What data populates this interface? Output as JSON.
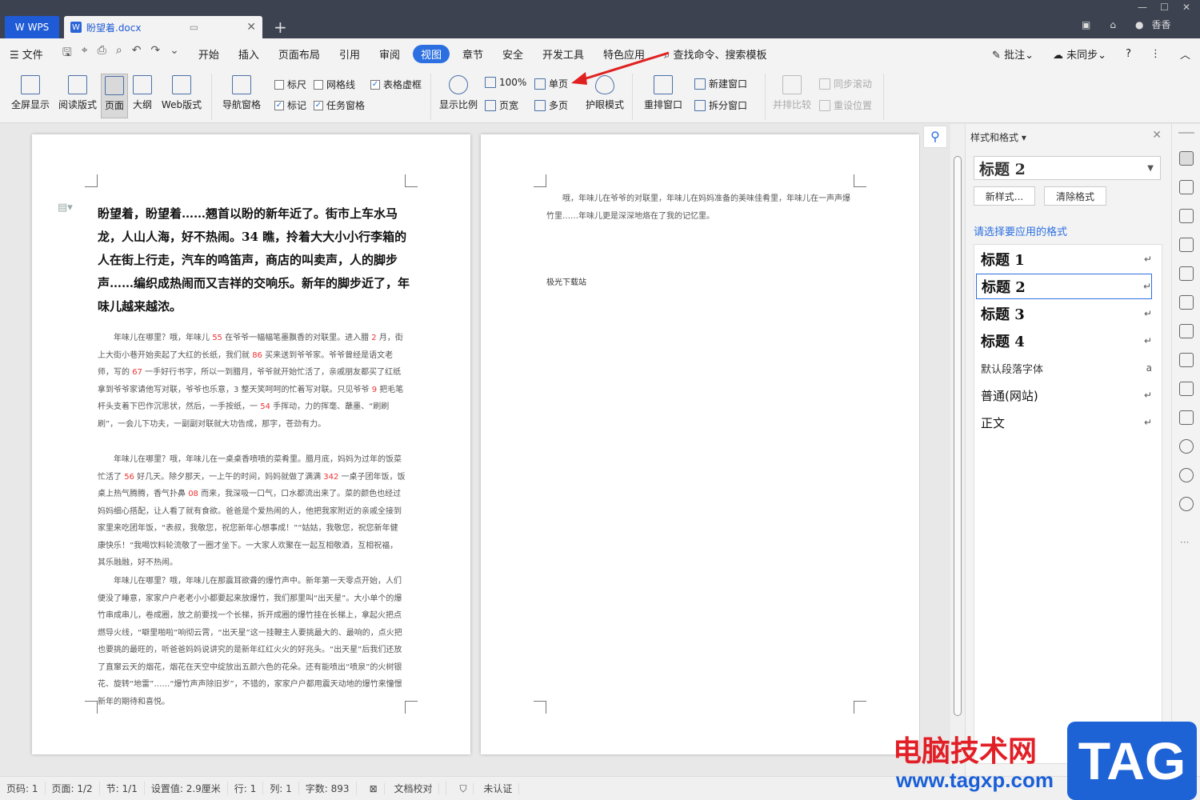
{
  "titlebar": {
    "wps_label": "WPS",
    "doc_tab": "盼望着.docx",
    "user": "香香"
  },
  "menu": {
    "file": "文件",
    "tabs": [
      "开始",
      "插入",
      "页面布局",
      "引用",
      "审阅",
      "视图",
      "章节",
      "安全",
      "开发工具",
      "特色应用"
    ],
    "search": "查找命令、搜索模板",
    "comment": "批注",
    "sync": "未同步"
  },
  "ribbon": {
    "fullscreen": "全屏显示",
    "reading": "阅读版式",
    "page": "页面",
    "outline": "大纲",
    "web": "Web版式",
    "nav": "导航窗格",
    "ruler": "标尺",
    "gridlines": "网格线",
    "table_gridlines": "表格虚框",
    "marks": "标记",
    "taskpane": "任务窗格",
    "zoom_label": "显示比例",
    "zoom_pct": "100%",
    "single": "单页",
    "pagewidth": "页宽",
    "multi": "多页",
    "eye": "护眼模式",
    "arrange": "重排窗口",
    "new_win": "新建窗口",
    "split_win": "拆分窗口",
    "side_by_side": "并排比较",
    "sync_scroll": "同步滚动",
    "reset_pos": "重设位置"
  },
  "doc": {
    "title": "盼望着，盼望着……翘首以盼的新年近了。街市上车水马龙，人山人海，好不热闹。34 瞧，拎着大大小小行李箱的人在街上行走，汽车的鸣笛声，商店的叫卖声，人的脚步声……编织成热闹而又吉祥的交响乐。新年的脚步近了，年味儿越来越浓。",
    "p1": "年味儿在哪里？哦，年味儿 55 在爷爷一幅幅笔墨飘香的对联里。进入腊 2 月，街上大街小巷开始卖起了大红的长纸，我们就 86 买来送到爷爷家。爷爷曾经是语文老师，写的 67 一手好行书字，所以一到腊月，爷爷就开始忙活了，亲戚朋友都买了红纸拿到爷爷家请他写对联，爷爷也乐意，3 整天笑呵呵的忙着写对联。只见爷爷 9 把毛笔杆头支着下巴作沉思状，然后，一手按纸，一 54 手挥动，力的挥毫、蘸墨、“刷刷刷”，一会儿下功夫，一副副对联就大功告成，那字，苍劲有力。",
    "p2": "年味儿在哪里？哦，年味儿在一桌桌香喷喷的菜肴里。腊月底，妈妈为过年的饭菜忙活了 56 好几天。除夕那天，一上午的时间，妈妈就做了满满 342 一桌子团年饭，饭桌上热气腾腾，香气扑鼻 08 而来，我深吸一口气，口水都流出来了。菜的颜色也经过妈妈细心搭配，让人看了就有食欲。爸爸是个爱热闹的人，他把我家附近的亲戚全接到家里来吃团年饭，“表叔，我敬您，祝您新年心想事成！”“姑姑，我敬您，祝您新年健康快乐！”我喝饮料轮流敬了一圈才坐下。一大家人欢聚在一起互相敬酒，互相祝福，其乐融融，好不热闹。",
    "p3": "年味儿在哪里？哦，年味儿在那震耳欲聋的爆竹声中。新年第一天零点开始，人们便没了睡意，家家户户老老小小都要起来放爆竹，我们那里叫“出天星”。大小单个的爆竹串成串儿，卷成圈，放之前要找一个长梯，拆开成圈的爆竹挂在长梯上，拿起火把点燃导火线，“噼里啪啦”响彻云霄，“出天星”这一挂鞭主人要挑最大的、最响的，点火把也要挑的最旺的，听爸爸妈妈说讲究的是新年红红火火的好兆头。“出天星”后我们还放了直窜云天的烟花，烟花在天空中绽放出五颜六色的花朵。还有能喷出“喷泉”的火树银花、旋转“地雷”……“爆竹声声除旧岁”，不错的，家家户户都用震天动地的爆竹来憧憬新年的期待和喜悦。",
    "page2_text": "哦，年味儿在爷爷的对联里，年味儿在妈妈准备的美味佳肴里，年味儿在一声声爆竹里……年味儿更是深深地烙在了我的记忆里。",
    "page2_note": "极光下载站"
  },
  "panel": {
    "header": "样式和格式",
    "current": "标题  2",
    "new_style": "新样式...",
    "clear": "清除格式",
    "hint": "请选择要应用的格式",
    "styles": [
      {
        "name": "标题  1",
        "kind": "heading",
        "mark": "↵"
      },
      {
        "name": "标题  2",
        "kind": "heading",
        "mark": "↵"
      },
      {
        "name": "标题  3",
        "kind": "heading",
        "mark": "↵"
      },
      {
        "name": "标题  4",
        "kind": "heading",
        "mark": "↵"
      },
      {
        "name": "默认段落字体",
        "kind": "small",
        "mark": "a"
      },
      {
        "name": "普通(网站)",
        "kind": "normal",
        "mark": "↵"
      },
      {
        "name": "正文",
        "kind": "normal",
        "mark": "↵"
      }
    ]
  },
  "status": {
    "page_no": "页码: 1",
    "page": "页面: 1/2",
    "section": "节: 1/1",
    "setting": "设置值: 2.9厘米",
    "row": "行: 1",
    "col": "列: 1",
    "words": "字数: 893",
    "proof": "文档校对",
    "cert": "未认证"
  },
  "watermark": {
    "cn": "电脑技术网",
    "url": "www.tagxp.com",
    "tag": "TAG"
  },
  "colors": {
    "accent": "#2b6fe0",
    "titlebar": "#3c4250",
    "red_digits": "#e33333"
  }
}
